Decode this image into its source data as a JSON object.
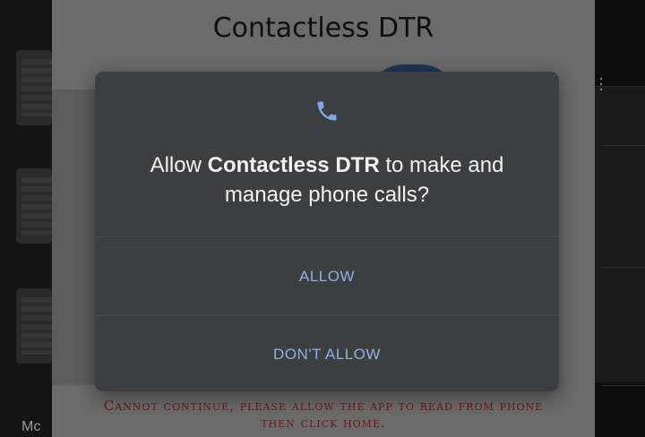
{
  "background": {
    "left_text": "Mc"
  },
  "app": {
    "title": "Contactless DTR",
    "warning": "Cannot continue, please allow the app to read from phone then click home."
  },
  "dialog": {
    "icon": "phone-icon",
    "message_prefix": "Allow ",
    "app_name": "Contactless DTR",
    "message_suffix": " to make and manage phone calls?",
    "allow_label": "ALLOW",
    "deny_label": "DON'T ALLOW"
  },
  "colors": {
    "dialog_bg": "#3d3e40",
    "accent": "#8fb0e6",
    "warning": "#6e1616"
  }
}
